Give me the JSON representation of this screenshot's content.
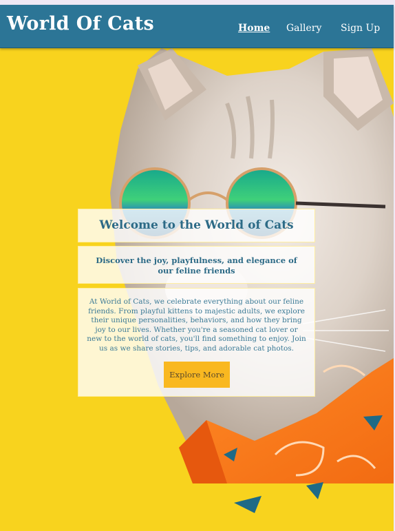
{
  "header": {
    "brand": "World Of Cats",
    "nav": [
      {
        "label": "Home"
      },
      {
        "label": "Gallery"
      },
      {
        "label": "Sign Up"
      }
    ]
  },
  "hero": {
    "title": "Welcome to the World of Cats",
    "subtitle": "Discover the joy, playfulness, and elegance of our feline friends",
    "body": "At World of Cats, we celebrate everything about our feline friends. From playful kittens to majestic adults, we explore their unique personalities, behaviors, and how they bring joy to our lives. Whether you're a seasoned cat lover or new to the world of cats, you'll find something to enjoy. Join us as we share stories, tips, and adorable cat photos.",
    "button": "Explore More"
  },
  "colors": {
    "navbar": "#2c7596",
    "background_yellow": "#f8d31e",
    "button": "#f9b820",
    "text_accent": "#2c6a86"
  }
}
